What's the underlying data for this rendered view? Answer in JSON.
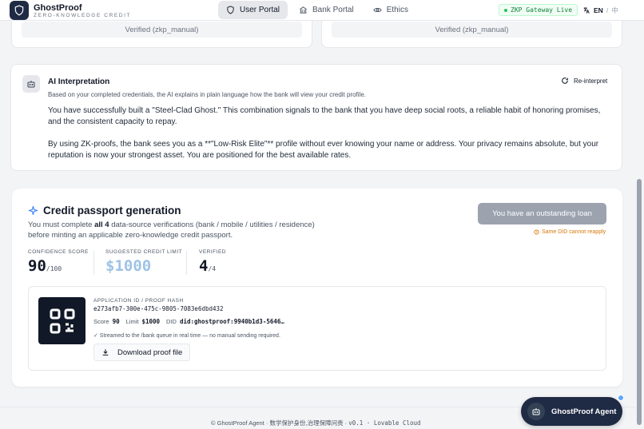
{
  "header": {
    "brand_name": "GhostProof",
    "brand_sub": "ZERO-KNOWLEDGE CREDIT",
    "nav": [
      {
        "label": "User Portal",
        "icon": "shield-icon",
        "active": true
      },
      {
        "label": "Bank Portal",
        "icon": "bank-icon",
        "active": false
      },
      {
        "label": "Ethics",
        "icon": "eye-icon",
        "active": false
      }
    ],
    "gateway_status": "ZKP Gateway Live",
    "lang_current": "EN",
    "lang_sep": "/",
    "lang_other": "中"
  },
  "top_cards": {
    "left_verified": "Verified (zkp_manual)",
    "right_verified": "Verified (zkp_manual)"
  },
  "ai": {
    "title": "AI Interpretation",
    "reinterpret_label": "Re-interpret",
    "subtitle": "Based on your completed credentials, the AI explains in plain language how the bank will view your credit profile.",
    "para1": "You have successfully built a \"Steel-Clad Ghost.\" This combination signals to the bank that you have deep social roots, a reliable habit of honoring promises, and the consistent capacity to repay.",
    "para2": "By using ZK-proofs, the bank sees you as a **\"Low-Risk Elite\"** profile without ever knowing your name or address. Your privacy remains absolute, but your reputation is now your strongest asset. You are positioned for the best available rates."
  },
  "passport": {
    "title": "Credit passport generation",
    "desc_pre": "You must complete ",
    "desc_bold": "all 4",
    "desc_post": " data-source verifications (bank / mobile / utilities / residence) before minting an applicable zero-knowledge credit passport.",
    "loan_button": "You have an outstanding loan",
    "reapply_note": "Same DID cannot reapply",
    "stats": {
      "confidence_label": "CONFIDENCE SCORE",
      "confidence_value": "90",
      "confidence_max": "/100",
      "limit_label": "SUGGESTED CREDIT LIMIT",
      "limit_value": "$1000",
      "verified_label": "VERIFIED",
      "verified_value": "4",
      "verified_max": "/4"
    },
    "proof": {
      "label": "APPLICATION ID / PROOF HASH",
      "hash": "e273afb7-300e-475c-9805-7083e6dbd432",
      "score_label": "Score",
      "score_value": "90",
      "limit_label": "Limit",
      "limit_value": "$1000",
      "did_label": "DID",
      "did_value": "did:ghostproof:9940b1d3-5646…",
      "stream_note": "✓ Streamed to the /bank queue in real time — no manual sending required.",
      "download_label": "Download proof file"
    }
  },
  "footer": {
    "text": "© GhostProof Agent · 数学保护身份,治理保障问责 · ",
    "version": "v0.1 · Lovable Cloud"
  },
  "agent": {
    "label": "GhostProof Agent"
  }
}
